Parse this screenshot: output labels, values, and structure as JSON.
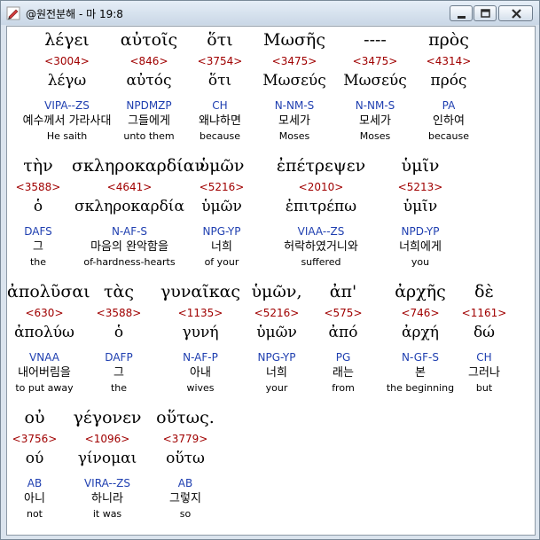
{
  "window": {
    "title": "@원전분해 - 마 19:8",
    "controls": {
      "minimize": "minimize",
      "maximize": "maximize",
      "close": "close"
    }
  },
  "rows": [
    {
      "words": [
        {
          "greek": "λέγει",
          "strong": "<3004>",
          "lemma": "λέγω",
          "morph": "VIPA--ZS",
          "korean": "예수께서 가라사대",
          "english": "He saith"
        },
        {
          "greek": "αὐτοῖς",
          "strong": "<846>",
          "lemma": "αὐτός",
          "morph": "NPDMZP",
          "korean": "그들에게",
          "english": "unto them"
        },
        {
          "greek": "ὅτι",
          "strong": "<3754>",
          "lemma": "ὅτι",
          "morph": "CH",
          "korean": "왜냐하면",
          "english": "because"
        },
        {
          "greek": "Μωσῆς",
          "strong": "<3475>",
          "lemma": "Μωσεύς",
          "morph": "N-NM-S",
          "korean": "모세가",
          "english": "Moses"
        },
        {
          "greek": "----",
          "strong": "<3475>",
          "lemma": "Μωσεύς",
          "morph": "N-NM-S",
          "korean": "모세가",
          "english": "Moses"
        },
        {
          "greek": "πρὸς",
          "strong": "<4314>",
          "lemma": "πρός",
          "morph": "PA",
          "korean": "인하여",
          "english": "because"
        }
      ]
    },
    {
      "words": [
        {
          "greek": "τὴν",
          "strong": "<3588>",
          "lemma": "ὁ",
          "morph": "DAFS",
          "korean": "그",
          "english": "the"
        },
        {
          "greek": "σκληροκαρδίαν",
          "strong": "<4641>",
          "lemma": "σκληροκαρδία",
          "morph": "N-AF-S",
          "korean": "마음의 완악함을",
          "english": "of-hardness-hearts"
        },
        {
          "greek": "ὑμῶν",
          "strong": "<5216>",
          "lemma": "ὑμῶν",
          "morph": "NPG-YP",
          "korean": "너희",
          "english": "of your"
        },
        {
          "greek": "ἐπέτρεψεν",
          "strong": "<2010>",
          "lemma": "ἐπιτρέπω",
          "morph": "VIAA--ZS",
          "korean": "허락하였거니와",
          "english": "suffered"
        },
        {
          "greek": "ὑμῖν",
          "strong": "<5213>",
          "lemma": "ὑμῖν",
          "morph": "NPD-YP",
          "korean": "너희에게",
          "english": "you"
        }
      ]
    },
    {
      "words": [
        {
          "greek": "ἀπολῦσαι",
          "strong": "<630>",
          "lemma": "ἀπολύω",
          "morph": "VNAA",
          "korean": "내어버림을",
          "english": "to put away"
        },
        {
          "greek": "τὰς",
          "strong": "<3588>",
          "lemma": "ὁ",
          "morph": "DAFP",
          "korean": "그",
          "english": "the"
        },
        {
          "greek": "γυναῖκας",
          "strong": "<1135>",
          "lemma": "γυνή",
          "morph": "N-AF-P",
          "korean": "아내",
          "english": "wives"
        },
        {
          "greek": "ὑμῶν,",
          "strong": "<5216>",
          "lemma": "ὑμῶν",
          "morph": "NPG-YP",
          "korean": "너희",
          "english": "your"
        },
        {
          "greek": "ἀπ'",
          "strong": "<575>",
          "lemma": "ἀπό",
          "morph": "PG",
          "korean": "래는",
          "english": "from"
        },
        {
          "greek": "ἀρχῆς",
          "strong": "<746>",
          "lemma": "ἀρχή",
          "morph": "N-GF-S",
          "korean": "본",
          "english": "the beginning"
        },
        {
          "greek": "δὲ",
          "strong": "<1161>",
          "lemma": "δώ",
          "morph": "CH",
          "korean": "그러나",
          "english": "but"
        }
      ]
    },
    {
      "words": [
        {
          "greek": "οὐ",
          "strong": "<3756>",
          "lemma": "ού",
          "morph": "AB",
          "korean": "아니",
          "english": "not"
        },
        {
          "greek": "γέγονεν",
          "strong": "<1096>",
          "lemma": "γίνομαι",
          "morph": "VIRA--ZS",
          "korean": "하니라",
          "english": "it was"
        },
        {
          "greek": "οὕτως.",
          "strong": "<3779>",
          "lemma": "οὕτω",
          "morph": "AB",
          "korean": "그렇지",
          "english": "so"
        }
      ]
    }
  ]
}
